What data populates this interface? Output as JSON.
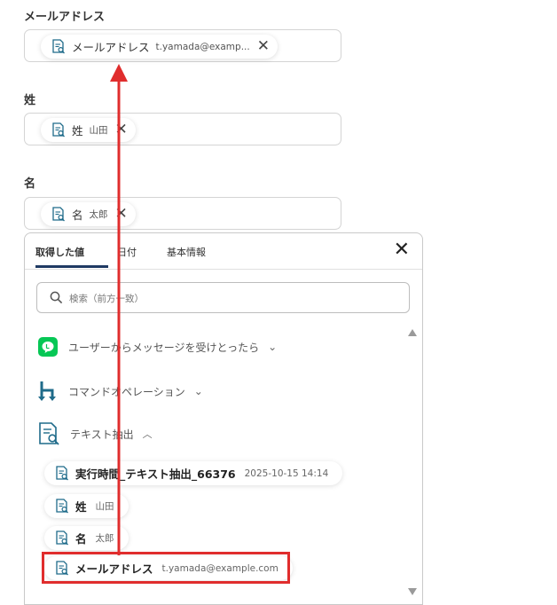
{
  "form": {
    "email": {
      "label": "メールアドレス",
      "chip_name": "メールアドレス",
      "chip_value": "t.yamada@examp..."
    },
    "last_name": {
      "label": "姓",
      "chip_name": "姓",
      "chip_value": "山田"
    },
    "first_name": {
      "label": "名",
      "chip_name": "名",
      "chip_value": "太郎"
    }
  },
  "panel": {
    "tabs": [
      "取得した値",
      "日付",
      "基本情報"
    ],
    "active_tab": "取得した値",
    "search_placeholder": "検索（前方一致）",
    "groups": [
      {
        "label": "ユーザーからメッセージを受けとったら",
        "icon": "line-app-icon",
        "expanded": false
      },
      {
        "label": "コマンドオペレーション",
        "icon": "branch-arrow-icon",
        "expanded": false
      },
      {
        "label": "テキスト抽出",
        "icon": "document-search-icon",
        "expanded": true
      }
    ],
    "items": [
      {
        "name": "実行時間_テキスト抽出_66376",
        "value": "2025-10-15 14:14"
      },
      {
        "name": "姓",
        "value": "山田"
      },
      {
        "name": "名",
        "value": "太郎"
      },
      {
        "name": "メールアドレス",
        "value": "t.yamada@example.com"
      }
    ]
  },
  "colors": {
    "accent_red": "#e02d2d",
    "tab_indicator": "#1f3a63",
    "line_green": "#06c755",
    "icon_teal": "#1f6b8a"
  }
}
